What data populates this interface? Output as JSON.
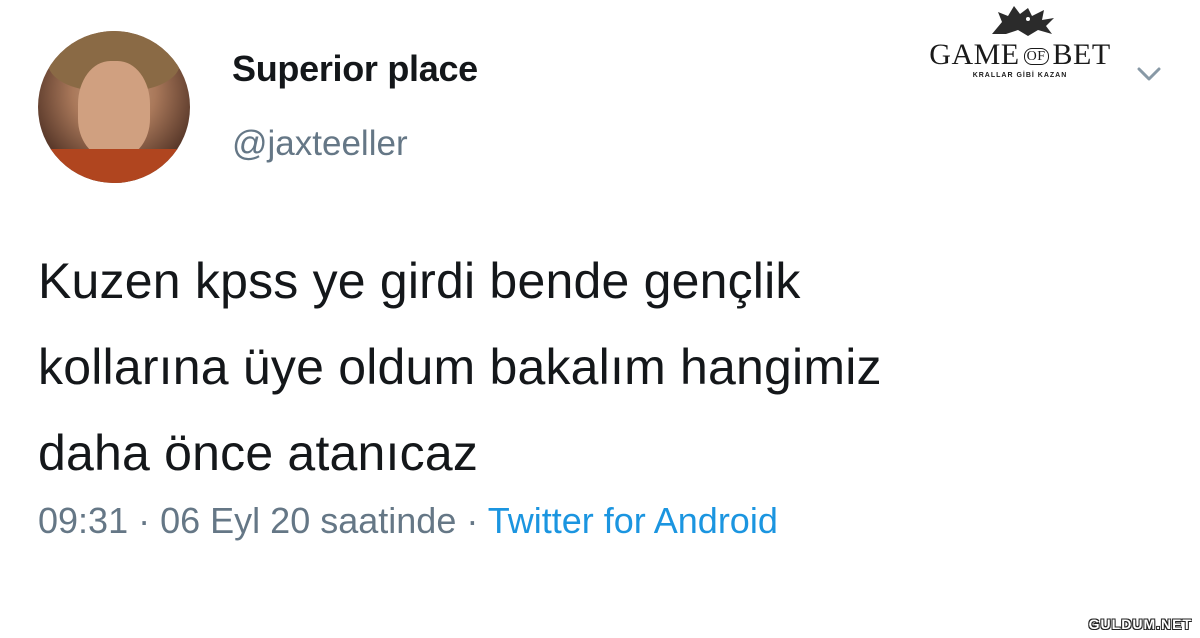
{
  "tweet": {
    "display_name": "Superior place",
    "handle": "@jaxteeller",
    "text_lines": [
      "Kuzen kpss ye girdi bende gençlik",
      "kollarına üye oldum bakalım hangimiz",
      "daha önce atanıcaz"
    ],
    "time": "09:31",
    "date": "06 Eyl 20 saatinde",
    "separator": "·",
    "source": "Twitter for Android",
    "menu_icon": "chevron-down-icon",
    "avatar_icon": "profile-photo"
  },
  "logo": {
    "brand_left": "GAME",
    "brand_of": "OF",
    "brand_right": "BET",
    "tagline": "KRALLAR GİBİ KAZAN",
    "icon": "wolf-head-icon"
  },
  "watermark": {
    "text": "GULDUM.NET"
  },
  "colors": {
    "text": "#14171a",
    "muted": "#657786",
    "link": "#1b95e0",
    "background": "#ffffff"
  }
}
